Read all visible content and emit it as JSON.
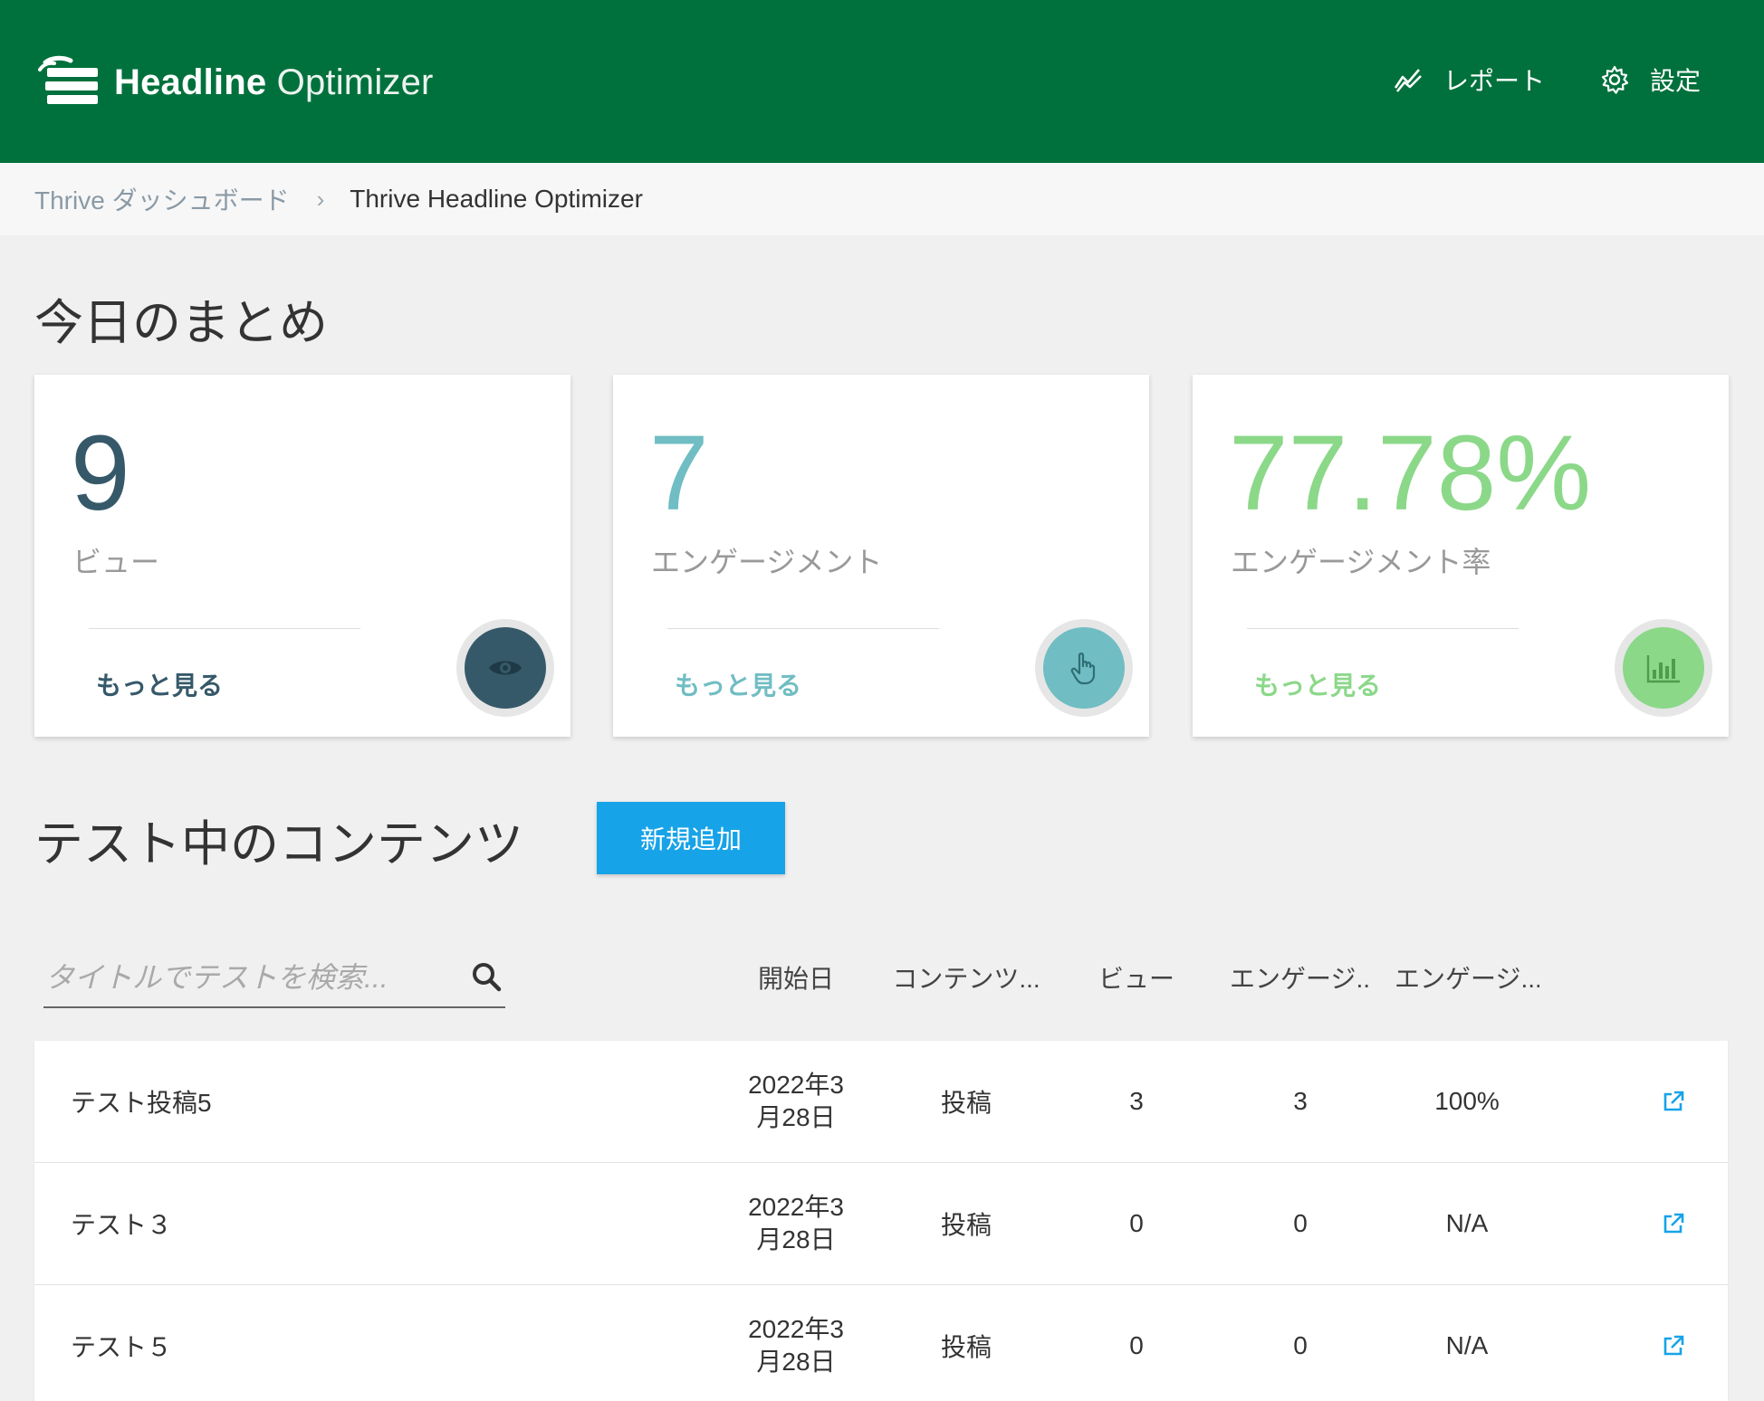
{
  "header": {
    "logo_bold": "Headline",
    "logo_light": " Optimizer",
    "nav": {
      "reports_label": "レポート",
      "reports_icon": "line-chart-icon",
      "settings_label": "設定",
      "settings_icon": "gear-icon"
    }
  },
  "breadcrumb": {
    "parent": "Thrive ダッシュボード",
    "separator": "›",
    "current": "Thrive Headline Optimizer"
  },
  "summary": {
    "title": "今日のまとめ",
    "cards": [
      {
        "value": "9",
        "label": "ビュー",
        "more": "もっと見る",
        "icon": "eye-icon",
        "color": "#36596a"
      },
      {
        "value": "7",
        "label": "エンゲージメント",
        "more": "もっと見る",
        "icon": "pointer-hand-icon",
        "color": "#70bdc3"
      },
      {
        "value": "77.78%",
        "label": "エンゲージメント率",
        "more": "もっと見る",
        "icon": "bar-chart-icon",
        "color": "#8bd889"
      }
    ]
  },
  "testing": {
    "title": "テスト中のコンテンツ",
    "add_button": "新規追加",
    "add_button_color": "#17a3e8",
    "search_placeholder": "タイトルでテストを検索...",
    "columns": {
      "date": "開始日",
      "type": "コンテンツ...",
      "views": "ビュー",
      "engagements": "エンゲージ...",
      "rate": "エンゲージ..."
    },
    "rows": [
      {
        "title": "テスト投稿5",
        "date_line1": "2022年3",
        "date_line2": "月28日",
        "type": "投稿",
        "views": "3",
        "engagements": "3",
        "rate": "100%"
      },
      {
        "title": "テスト３",
        "date_line1": "2022年3",
        "date_line2": "月28日",
        "type": "投稿",
        "views": "0",
        "engagements": "0",
        "rate": "N/A"
      },
      {
        "title": "テスト５",
        "date_line1": "2022年3",
        "date_line2": "月28日",
        "type": "投稿",
        "views": "0",
        "engagements": "0",
        "rate": "N/A"
      }
    ]
  },
  "colors": {
    "header_bg": "#00713c",
    "link_icon": "#17a3e8"
  }
}
